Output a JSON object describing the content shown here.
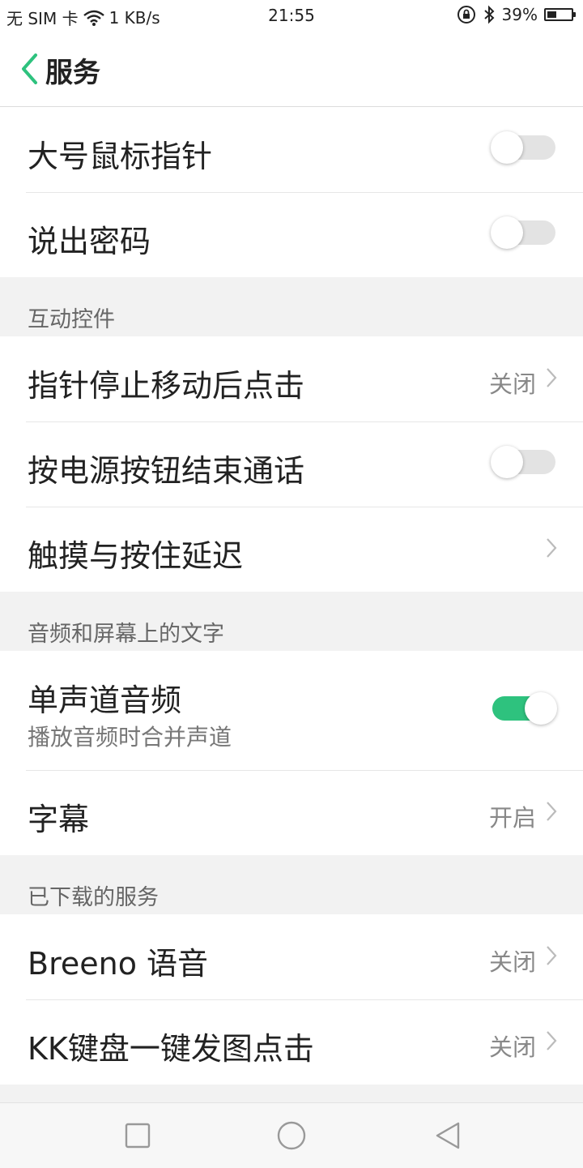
{
  "status_bar": {
    "carrier": "无 SIM 卡",
    "speed": "1 KB/s",
    "time": "21:55",
    "battery": "39%",
    "battery_level": 0.39
  },
  "header": {
    "title": "服务"
  },
  "groups": [
    {
      "section": "",
      "rows": [
        {
          "title": "大号鼠标指针",
          "control": "switch",
          "on": false
        },
        {
          "title": "说出密码",
          "control": "switch",
          "on": false
        }
      ]
    },
    {
      "section": "互动控件",
      "rows": [
        {
          "title": "指针停止移动后点击",
          "control": "chevron",
          "value": "关闭"
        },
        {
          "title": "按电源按钮结束通话",
          "control": "switch",
          "on": false
        },
        {
          "title": "触摸与按住延迟",
          "control": "chevron",
          "value": ""
        }
      ]
    },
    {
      "section": "音频和屏幕上的文字",
      "rows": [
        {
          "title": "单声道音频",
          "subtitle": "播放音频时合并声道",
          "control": "switch",
          "on": true
        },
        {
          "title": "字幕",
          "control": "chevron",
          "value": "开启"
        }
      ]
    },
    {
      "section": "已下载的服务",
      "rows": [
        {
          "title": "Breeno 语音",
          "control": "chevron",
          "value": "关闭"
        },
        {
          "title": "KK键盘一键发图点击",
          "control": "chevron",
          "value": "关闭"
        }
      ]
    }
  ],
  "colors": {
    "accent": "#2ec27e",
    "background": "#f2f2f2"
  },
  "icons": {
    "back": "chevron-left-icon",
    "wifi": "wifi-icon",
    "lock": "rotation-lock-icon",
    "bluetooth": "bluetooth-icon",
    "nav_recent": "square-icon",
    "nav_home": "circle-icon",
    "nav_back": "triangle-back-icon"
  }
}
